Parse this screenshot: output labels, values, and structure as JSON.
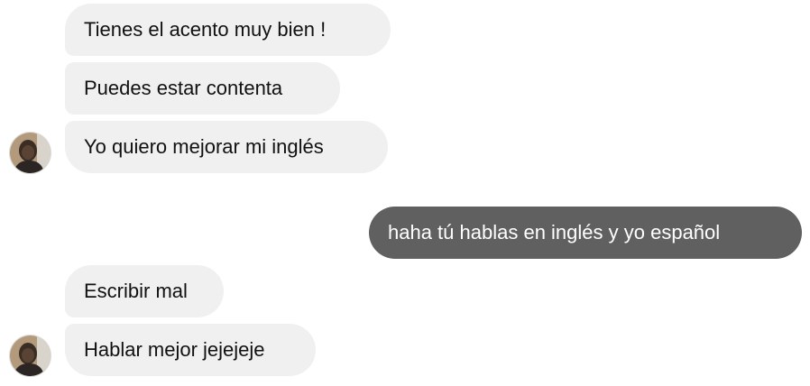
{
  "conversation": {
    "messages": [
      {
        "direction": "incoming",
        "text": "Tienes el acento muy bien !"
      },
      {
        "direction": "incoming",
        "text": "Puedes estar contenta"
      },
      {
        "direction": "incoming",
        "text": "Yo quiero mejorar mi inglés"
      },
      {
        "direction": "outgoing",
        "text": "haha tú hablas en inglés y yo español"
      },
      {
        "direction": "incoming",
        "text": "Escribir mal"
      },
      {
        "direction": "incoming",
        "text": "Hablar mejor jejejeje"
      }
    ]
  },
  "colors": {
    "incoming_bubble": "#f0f0f0",
    "outgoing_bubble": "#606060",
    "incoming_text": "#111111",
    "outgoing_text": "#ffffff"
  },
  "icons": {
    "avatar": "contact-avatar-icon"
  }
}
